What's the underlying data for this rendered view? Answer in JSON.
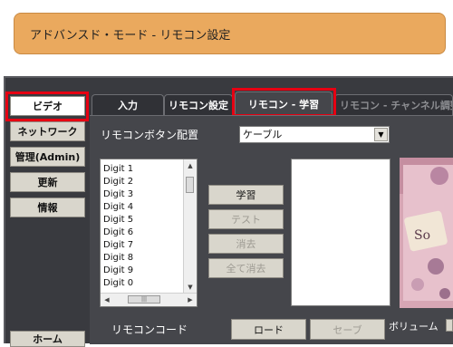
{
  "window": {
    "title": "アドバンスド・モード - リモコン設定"
  },
  "sidebar": {
    "items": [
      {
        "label": "ビデオ",
        "active": true
      },
      {
        "label": "ネットワーク"
      },
      {
        "label": "管理(Admin)"
      },
      {
        "label": "更新"
      },
      {
        "label": "情報"
      }
    ],
    "home_label": "ホーム"
  },
  "tabs": [
    {
      "label": "入力"
    },
    {
      "label": "リモコン設定"
    },
    {
      "label": "リモコン - 学習",
      "active": true
    },
    {
      "label": "リモコン - チャンネル調整"
    }
  ],
  "main": {
    "layout_label": "リモコンボタン配置",
    "layout_select": {
      "value": "ケーブル"
    },
    "buttons": {
      "learn": "学習",
      "test": "テスト",
      "clear": "消去",
      "clear_all": "全て消去"
    },
    "list_items": [
      "Digit 1",
      "Digit 2",
      "Digit 3",
      "Digit 4",
      "Digit 5",
      "Digit 6",
      "Digit 7",
      "Digit 8",
      "Digit 9",
      "Digit 0"
    ],
    "code_label": "リモコンコード",
    "load_label": "ロード",
    "save_label": "セーブ",
    "volume_label": "ボリューム"
  },
  "colors": {
    "title_bar": "#eaa95e",
    "frame": "#393a3f",
    "highlight": "#e60012"
  }
}
